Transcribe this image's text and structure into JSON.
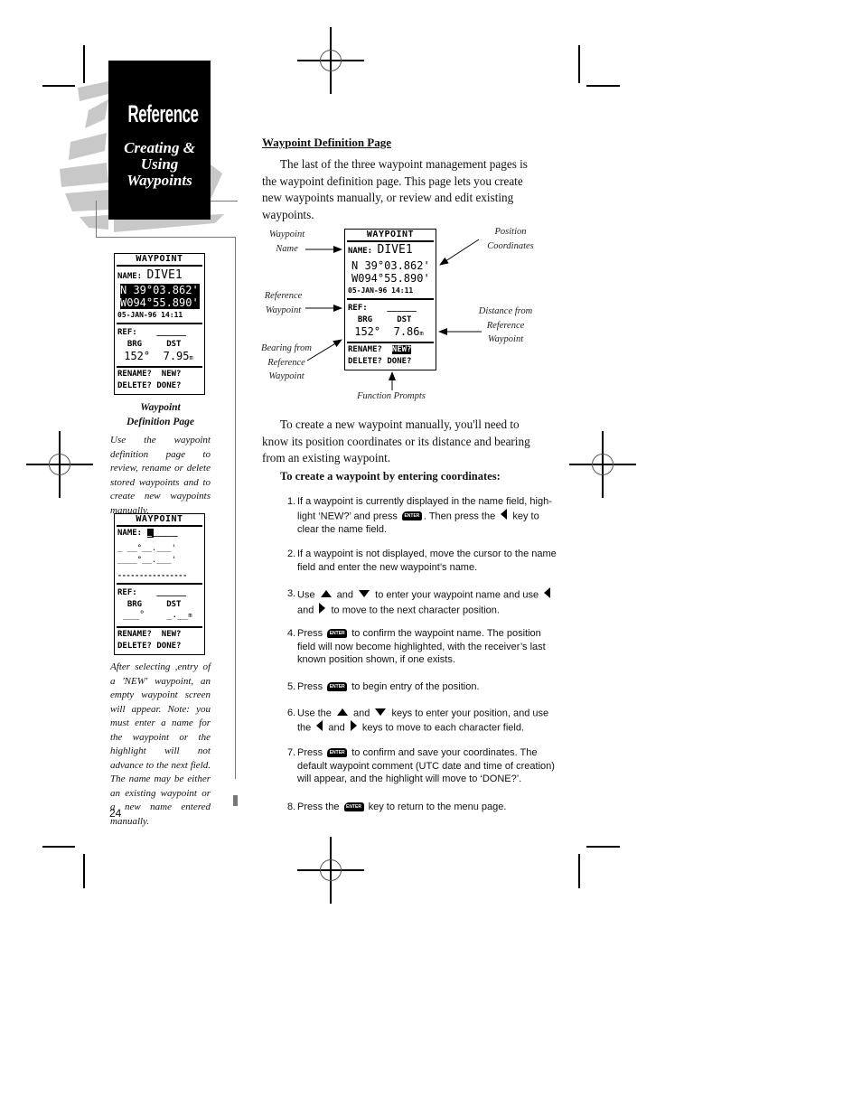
{
  "sidebar": {
    "tab_title": "Reference",
    "tab_subtitle_lines": [
      "Creating &",
      "Using",
      "Waypoints"
    ],
    "screen1": {
      "header": "WAYPOINT",
      "name_label": "NAME:",
      "name_value": "DIVE1",
      "lat": "N 39°03.862'",
      "lon": "W094°55.890'",
      "comment": "05-JAN-96 14:11",
      "ref_label": "REF:",
      "ref_value": "______",
      "brg_label": "BRG",
      "dst_label": "DST",
      "brg_value": "152°",
      "dst_value": "7.95",
      "dst_unit": "m",
      "prompt_rename": "RENAME?",
      "prompt_new": "NEW?",
      "prompt_delete": "DELETE?",
      "prompt_done": "DONE?"
    },
    "caption1_title": [
      "Waypoint",
      "Definition Page"
    ],
    "caption1_body": "Use the waypoint definition page to review, rename or delete stored waypoints and to create new waypoints manually.",
    "screen2": {
      "header": "WAYPOINT",
      "name_label": "NAME:",
      "name_value": "_____",
      "lat": "_ __°__.___'",
      "lon": "____°__.___'",
      "comment": "----------------",
      "ref_label": "REF:",
      "ref_value": "______",
      "brg_label": "BRG",
      "dst_label": "DST",
      "brg_value": "___°",
      "dst_value": "_.__",
      "dst_unit": "m",
      "prompt_rename": "RENAME?",
      "prompt_new": "NEW?",
      "prompt_delete": "DELETE?",
      "prompt_done": "DONE?"
    },
    "caption2_body": "After selecting ,entry of a 'NEW' waypoint, an empty waypoint screen will appear. Note: you must enter a name for the waypoint or the highlight will not advance to the next field. The name may be either an existing waypoint or a new name entered manually.",
    "page_number": "24"
  },
  "main": {
    "heading": "Waypoint Definition Page",
    "intro": "The last of the three waypoint management pages is the waypoint definition page. This page lets you create new waypoints manually, or review and edit existing waypoints.",
    "diagram": {
      "screen": {
        "header": "WAYPOINT",
        "name_label": "NAME:",
        "name_value": "DIVE1",
        "lat": "N 39°03.862'",
        "lon": "W094°55.890'",
        "comment": "05-JAN-96 14:11",
        "ref_label": "REF:",
        "ref_value": "______",
        "brg_label": "BRG",
        "dst_label": "DST",
        "brg_value": "152°",
        "dst_value": "7.86",
        "dst_unit": "m",
        "prompt_rename": "RENAME?",
        "prompt_new": "NEW?",
        "prompt_delete": "DELETE?",
        "prompt_done": "DONE?"
      },
      "callouts": {
        "waypoint_name": [
          "Waypoint",
          "Name"
        ],
        "position_coordinates": [
          "Position",
          "Coordinates"
        ],
        "reference_waypoint": [
          "Reference",
          "Waypoint"
        ],
        "distance_from_ref": [
          "Distance from",
          "Reference",
          "Waypoint"
        ],
        "bearing_from_ref": [
          "Bearing from",
          "Reference",
          "Waypoint"
        ],
        "function_prompts": "Function Prompts"
      }
    },
    "para2": "To create a new waypoint manually, you'll need to know its position coordinates or its distance and bearing from an existing waypoint.",
    "subheading": "To create a waypoint by entering coordinates:",
    "key_label": "ENTER",
    "steps": [
      {
        "num": "1.",
        "parts": [
          "If a waypoint is currently displayed in the name field, high-light ‘NEW?’ and press ",
          "[ENTER]",
          ". Then press the ",
          "[LEFT]",
          " key to clear the name field."
        ]
      },
      {
        "num": "2.",
        "parts": [
          "If a waypoint is not displayed, move the cursor to the name field and enter the new waypoint’s name."
        ]
      },
      {
        "num": "3.",
        "parts": [
          "Use ",
          "[UP]",
          " and ",
          "[DOWN]",
          " to enter your waypoint name and use ",
          "[LEFT]",
          " and ",
          "[RIGHT]",
          " to move to the next character position."
        ]
      },
      {
        "num": "4.",
        "parts": [
          "Press ",
          "[ENTER]",
          " to confirm the waypoint name. The position field will now become highlighted, with the receiver’s last known position shown, if one exists."
        ]
      },
      {
        "num": "5.",
        "parts": [
          "Press ",
          "[ENTER]",
          " to begin entry of the position."
        ]
      },
      {
        "num": "6.",
        "parts": [
          "Use the ",
          "[UP]",
          " and ",
          "[DOWN]",
          " keys to enter your position, and use the ",
          "[LEFT]",
          " and ",
          "[RIGHT]",
          " keys to move to each character field."
        ]
      },
      {
        "num": "7.",
        "parts": [
          "Press ",
          "[ENTER]",
          " to confirm and save your coordinates. The default waypoint comment (UTC date and time of creation) will appear, and the highlight will move to ‘DONE?’."
        ]
      },
      {
        "num": "8.",
        "parts": [
          "Press the ",
          "[ENTER]",
          " key to return to the menu page."
        ]
      }
    ]
  }
}
